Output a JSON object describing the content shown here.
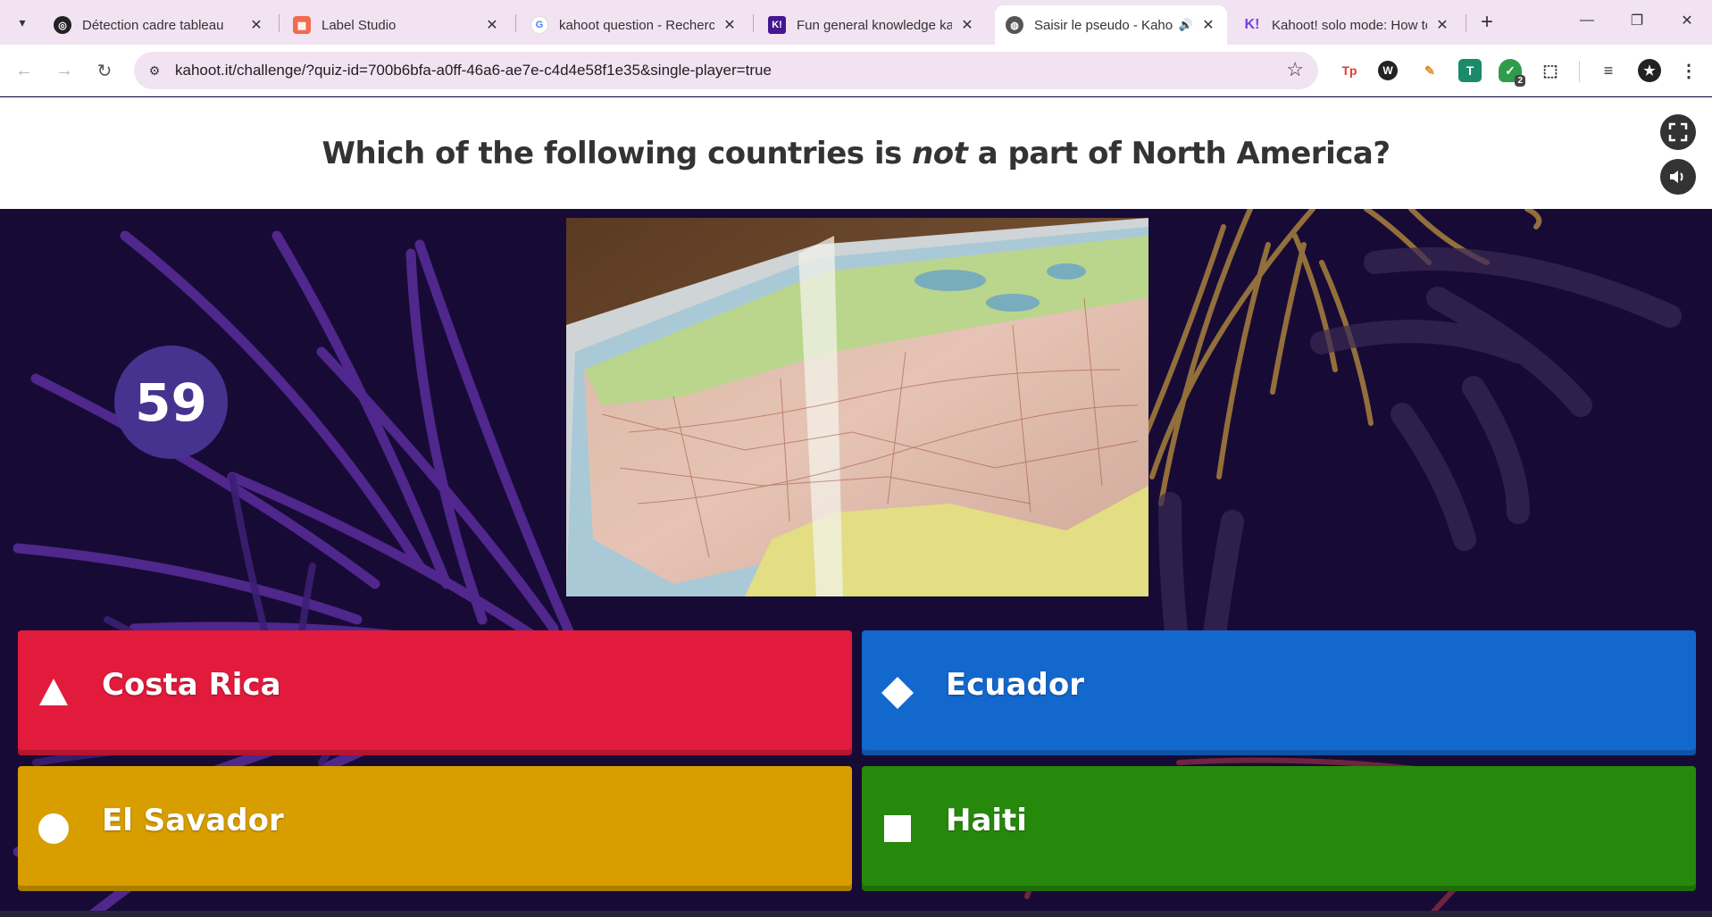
{
  "browser": {
    "tabs": [
      {
        "title": "Détection cadre tableau",
        "icon": "chatgpt-favicon",
        "active": false
      },
      {
        "title": "Label Studio",
        "icon": "label-studio-favicon",
        "active": false
      },
      {
        "title": "kahoot question - Recherche Google",
        "icon": "google-favicon",
        "active": false
      },
      {
        "title": "Fun general knowledge kahoot",
        "icon": "kahoot-favicon",
        "active": false
      },
      {
        "title": "Saisir le pseudo - Kahoot!",
        "icon": "globe-favicon",
        "active": true
      },
      {
        "title": "Kahoot! solo mode: How to",
        "icon": "kahoot-favicon",
        "active": false
      }
    ],
    "url": "kahoot.it/challenge/?quiz-id=700b6bfa-a0ff-46a6-ae7e-c4d4e58f1e35&single-player=true",
    "extensions": [
      {
        "name": "tp-extension-icon",
        "glyph": "Tp",
        "color": "#e53935"
      },
      {
        "name": "wordtune-extension-icon",
        "glyph": "W",
        "color": "#222222"
      },
      {
        "name": "color-picker-extension-icon",
        "glyph": "✎",
        "color": "#e08a2a"
      },
      {
        "name": "text-extension-icon",
        "glyph": "T",
        "color": "#1b8a6b"
      },
      {
        "name": "shield-extension-icon",
        "glyph": "✓",
        "color": "#2e9c4a",
        "badge": "2"
      },
      {
        "name": "puzzle-extensions-icon",
        "glyph": "⬚",
        "color": "#333333"
      }
    ]
  },
  "quiz": {
    "question_before": "Which of the following countries is ",
    "question_emphasis": "not",
    "question_after": " a part of North America?",
    "timer": "59",
    "answers": [
      {
        "label": "Costa Rica",
        "shape": "triangle",
        "color": "#e21b3c"
      },
      {
        "label": "Ecuador",
        "shape": "diamond",
        "color": "#1368ce"
      },
      {
        "label": "El Savador",
        "shape": "circle",
        "color": "#d89e00"
      },
      {
        "label": "Haiti",
        "shape": "square",
        "color": "#26890c"
      }
    ]
  }
}
